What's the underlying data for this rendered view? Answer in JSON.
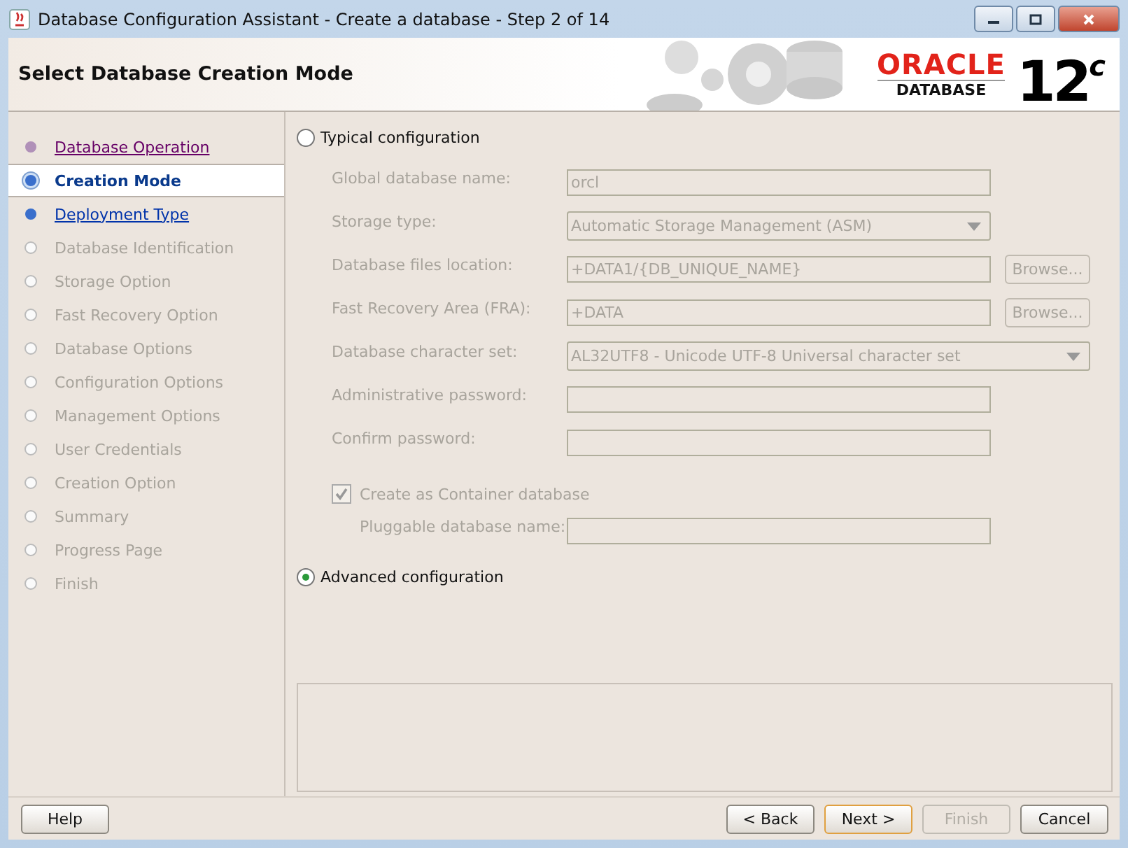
{
  "window": {
    "title": "Database Configuration Assistant - Create a database - Step 2 of 14"
  },
  "header": {
    "title": "Select Database Creation Mode",
    "logo_brand": "ORACLE",
    "logo_product": "DATABASE",
    "logo_version": "12",
    "logo_suffix": "c"
  },
  "steps": [
    {
      "label": "Database Operation",
      "kind": "visited",
      "selected": false
    },
    {
      "label": "Creation Mode",
      "kind": "current",
      "selected": true
    },
    {
      "label": "Deployment Type",
      "kind": "link",
      "selected": false
    },
    {
      "label": "Database Identification",
      "kind": "disabled",
      "selected": false
    },
    {
      "label": "Storage Option",
      "kind": "disabled",
      "selected": false
    },
    {
      "label": "Fast Recovery Option",
      "kind": "disabled",
      "selected": false
    },
    {
      "label": "Database Options",
      "kind": "disabled",
      "selected": false
    },
    {
      "label": "Configuration Options",
      "kind": "disabled",
      "selected": false
    },
    {
      "label": "Management Options",
      "kind": "disabled",
      "selected": false
    },
    {
      "label": "User Credentials",
      "kind": "disabled",
      "selected": false
    },
    {
      "label": "Creation Option",
      "kind": "disabled",
      "selected": false
    },
    {
      "label": "Summary",
      "kind": "disabled",
      "selected": false
    },
    {
      "label": "Progress Page",
      "kind": "disabled",
      "selected": false
    },
    {
      "label": "Finish",
      "kind": "disabled",
      "selected": false
    }
  ],
  "typical": {
    "label": "Typical configuration",
    "selected": false,
    "disabled": true,
    "fields": [
      {
        "kind": "text",
        "label": "Global database name:",
        "value": "orcl"
      },
      {
        "kind": "dropdown",
        "label": "Storage type:",
        "value": "Automatic Storage Management (ASM)"
      },
      {
        "kind": "browse",
        "label": "Database files location:",
        "value": "+DATA1/{DB_UNIQUE_NAME}",
        "button": "Browse..."
      },
      {
        "kind": "browse",
        "label": "Fast Recovery Area (FRA):",
        "value": "+DATA",
        "button": "Browse..."
      },
      {
        "kind": "wide-dropdown",
        "label": "Database character set:",
        "value": "AL32UTF8 - Unicode UTF-8 Universal character set"
      },
      {
        "kind": "text",
        "label": "Administrative password:"
      },
      {
        "kind": "text",
        "label": "Confirm password:"
      }
    ],
    "container": {
      "label": "Create as Container database",
      "checked": true
    },
    "pluggable": {
      "label": "Pluggable database name:"
    }
  },
  "advanced": {
    "label": "Advanced configuration",
    "selected": true
  },
  "buttons": {
    "help": {
      "label": "Help"
    },
    "nav": [
      {
        "label": "< Back",
        "disabled": false,
        "default": false
      },
      {
        "label": "Next >",
        "disabled": false,
        "default": true
      },
      {
        "label": "Finish",
        "disabled": true,
        "default": false
      },
      {
        "label": "Cancel",
        "disabled": false,
        "default": false
      }
    ]
  }
}
